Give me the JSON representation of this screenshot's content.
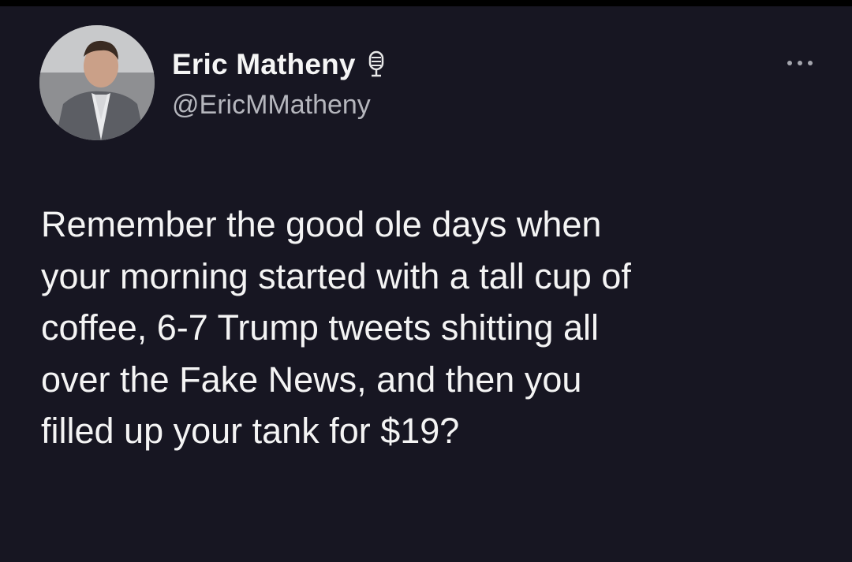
{
  "author": {
    "display_name": "Eric Matheny",
    "handle": "@EricMMatheny",
    "badge_icon": "microphone-icon",
    "avatar_icon": "profile-photo"
  },
  "tweet": {
    "text": "Remember the good ole days when\nyour morning started with a tall cup of\ncoffee, 6-7 Trump tweets shitting all\nover the Fake News, and then you\nfilled up your tank for $19?"
  },
  "menu": {
    "icon": "more-options-icon"
  },
  "colors": {
    "background": "#171622",
    "text": "#f4f4f4",
    "secondary_text": "#b5b6bd"
  }
}
